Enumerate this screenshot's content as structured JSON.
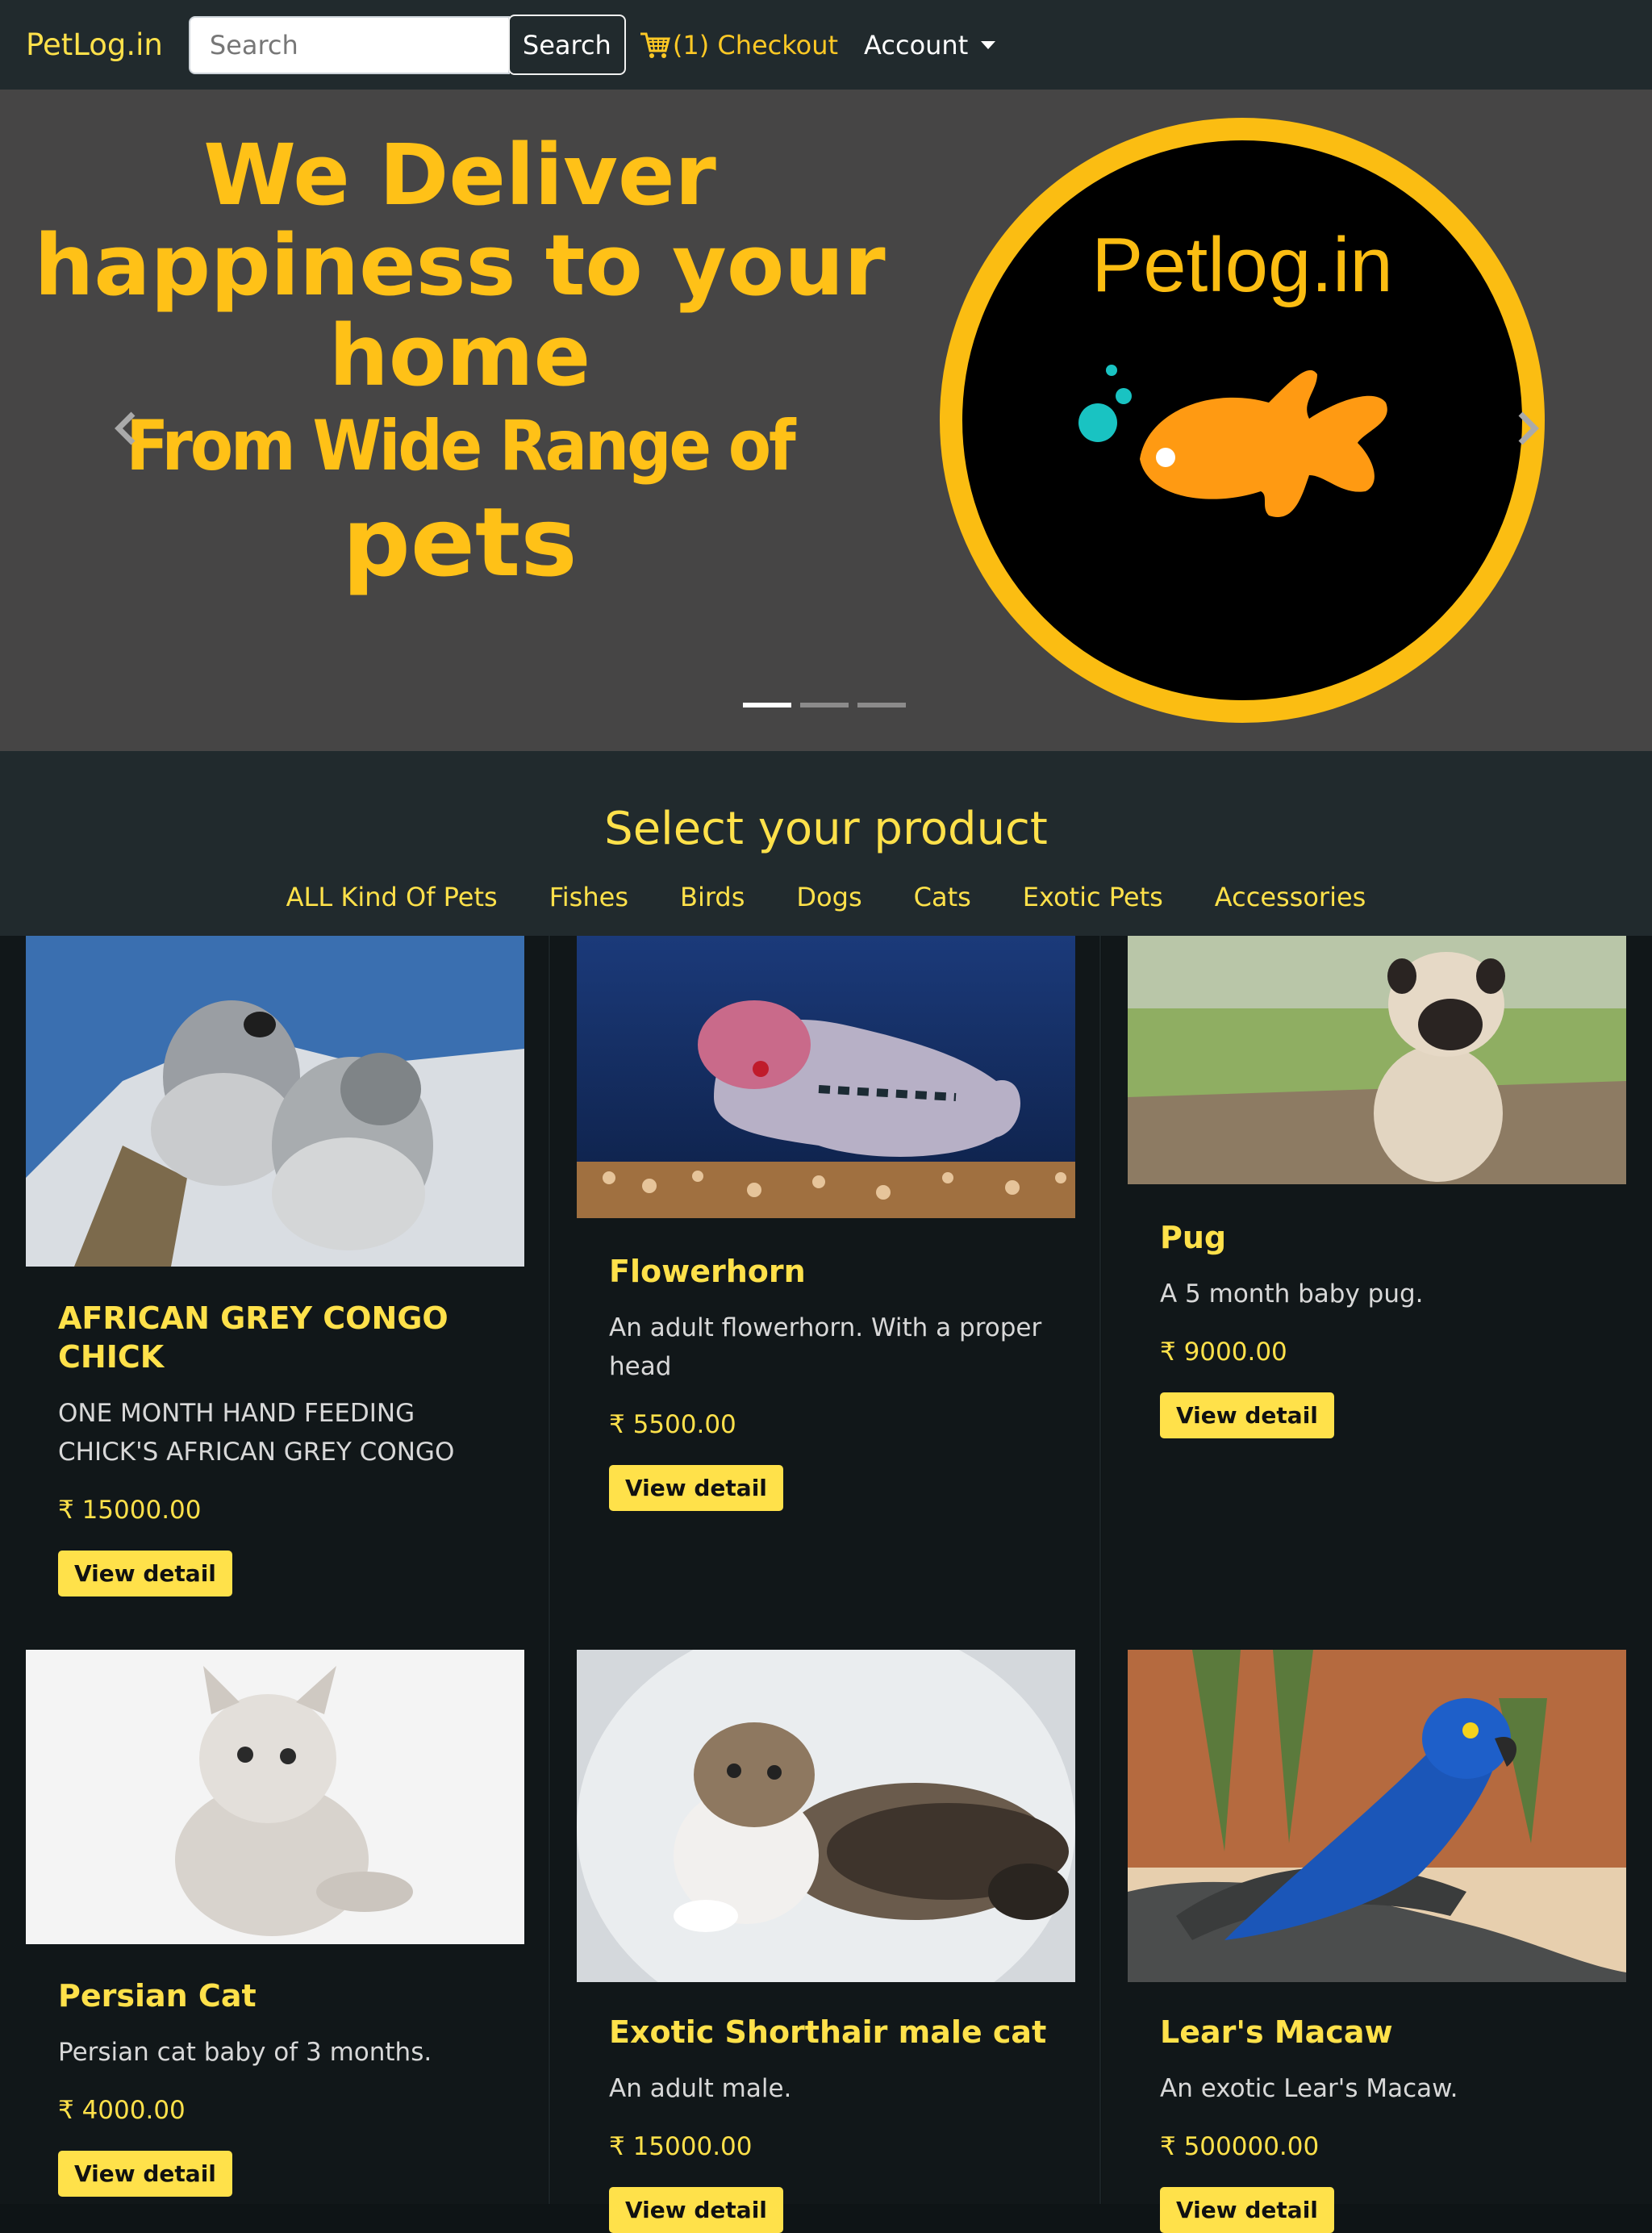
{
  "navbar": {
    "brand": "PetLog.in",
    "search_placeholder": "Search",
    "search_button": "Search",
    "checkout_label": "(1) Checkout",
    "account_label": "Account"
  },
  "hero": {
    "line1": "We Deliver",
    "line2": "happiness to your",
    "line3": "home",
    "line4a": "From Wide Range of",
    "line4b": "pets",
    "logo_text": "Petlog.in",
    "slides": 3,
    "active_slide": 1
  },
  "section": {
    "title": "Select your product",
    "categories": [
      "ALL Kind Of Pets",
      "Fishes",
      "Birds",
      "Dogs",
      "Cats",
      "Exotic Pets",
      "Accessories"
    ]
  },
  "products": [
    {
      "title": "AFRICAN GREY CONGO CHICK",
      "desc": "ONE MONTH HAND FEEDING CHICK'S AFRICAN GREY CONGO",
      "price": "₹ 15000.00",
      "button": "View detail"
    },
    {
      "title": "Flowerhorn",
      "desc": "An adult flowerhorn. With a proper head",
      "price": "₹ 5500.00",
      "button": "View detail"
    },
    {
      "title": "Pug",
      "desc": "A 5 month baby pug.",
      "price": "₹ 9000.00",
      "button": "View detail"
    },
    {
      "title": "Persian Cat",
      "desc": "Persian cat baby of 3 months.",
      "price": "₹ 4000.00",
      "button": "View detail"
    },
    {
      "title": "Exotic Shorthair male cat",
      "desc": "An adult male.",
      "price": "₹ 15000.00",
      "button": "View detail"
    },
    {
      "title": "Lear's Macaw",
      "desc": "An exotic Lear's Macaw.",
      "price": "₹ 500000.00",
      "button": "View detail"
    }
  ],
  "colors": {
    "accent": "#ffe14a",
    "navbar": "#212a2d",
    "page": "#0e1416",
    "hero": "#464545",
    "logo_ring": "#fbbd12"
  }
}
